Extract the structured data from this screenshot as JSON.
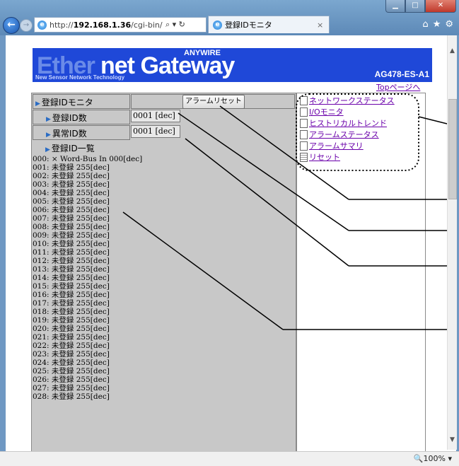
{
  "browser": {
    "url_prefix": "http://",
    "url_host": "192.168.1.36",
    "url_path": "/cgi-bin/",
    "address_tools": "⌕ ▾ ↻",
    "tab_title": "登録IDモニタ",
    "tab_close": "×",
    "home_icon": "⌂",
    "star_icon": "★",
    "gear_icon": "⚙",
    "zoom": "🔍100%  ▾"
  },
  "header": {
    "logo_ether": "Ether",
    "logo_net": "net Gateway",
    "logo_anywire": "ANYWIRE",
    "logo_tagline": "New Sensor Network Technology",
    "model": "AG478-ES-A1",
    "top_link": "Topページへ"
  },
  "monitor": {
    "title": "登録IDモニタ",
    "alarm_reset_button": "アラームリセット",
    "registered_count_label": "登録ID数",
    "registered_count_value": "0001 [dec]",
    "abnormal_count_label": "異常ID数",
    "abnormal_count_value": "0001 [dec]",
    "list_label": "登録ID一覧",
    "list_items": [
      "000: × Word-Bus In 000[dec]",
      "001: 未登録 255[dec]",
      "002: 未登録 255[dec]",
      "003: 未登録 255[dec]",
      "004: 未登録 255[dec]",
      "005: 未登録 255[dec]",
      "006: 未登録 255[dec]",
      "007: 未登録 255[dec]",
      "008: 未登録 255[dec]",
      "009: 未登録 255[dec]",
      "010: 未登録 255[dec]",
      "011: 未登録 255[dec]",
      "012: 未登録 255[dec]",
      "013: 未登録 255[dec]",
      "014: 未登録 255[dec]",
      "015: 未登録 255[dec]",
      "016: 未登録 255[dec]",
      "017: 未登録 255[dec]",
      "018: 未登録 255[dec]",
      "019: 未登録 255[dec]",
      "020: 未登録 255[dec]",
      "021: 未登録 255[dec]",
      "022: 未登録 255[dec]",
      "023: 未登録 255[dec]",
      "024: 未登録 255[dec]",
      "025: 未登録 255[dec]",
      "026: 未登録 255[dec]",
      "027: 未登録 255[dec]",
      "028: 未登録 255[dec]"
    ]
  },
  "sidebar": {
    "links": [
      {
        "label": "ネットワークステータス",
        "icon": "doc-icon"
      },
      {
        "label": "I/Oモニタ",
        "icon": "doc-icon"
      },
      {
        "label": "ヒストリカルトレンド",
        "icon": "doc-icon"
      },
      {
        "label": "アラームステータス",
        "icon": "doc-icon"
      },
      {
        "label": "アラームサマリ",
        "icon": "doc-icon"
      },
      {
        "label": "リセット",
        "icon": "grid-doc-icon"
      }
    ]
  },
  "colors": {
    "banner_blue": "#1f48d8",
    "panel_gray": "#c8c8c8",
    "link_purple": "#6a00aa",
    "triangle_blue": "#2a6cc4"
  }
}
